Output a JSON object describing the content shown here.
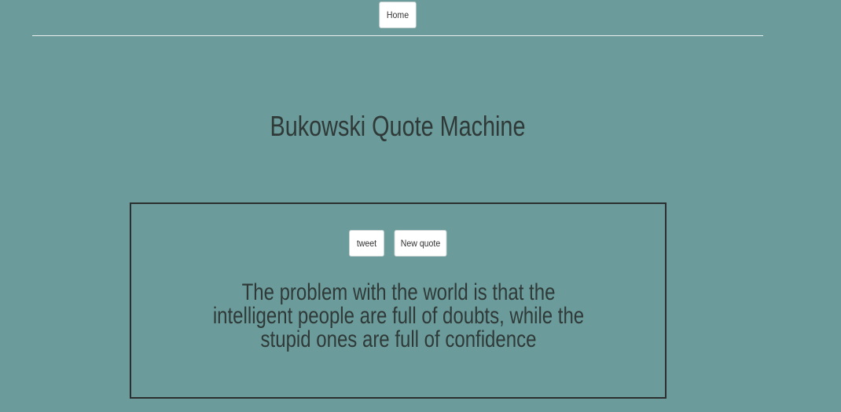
{
  "nav": {
    "home_label": "Home"
  },
  "page": {
    "title": "Bukowski Quote Machine"
  },
  "quote_box": {
    "tweet_label": "tweet",
    "new_quote_label": "New quote",
    "quote_text": "The problem with the world is that the intelligent people are full of doubts, while the stupid ones are full of confidence"
  },
  "colors": {
    "background": "#6b9c9b",
    "text": "#2f3a38",
    "border": "#2b2f2f",
    "button_bg": "#ffffff"
  }
}
